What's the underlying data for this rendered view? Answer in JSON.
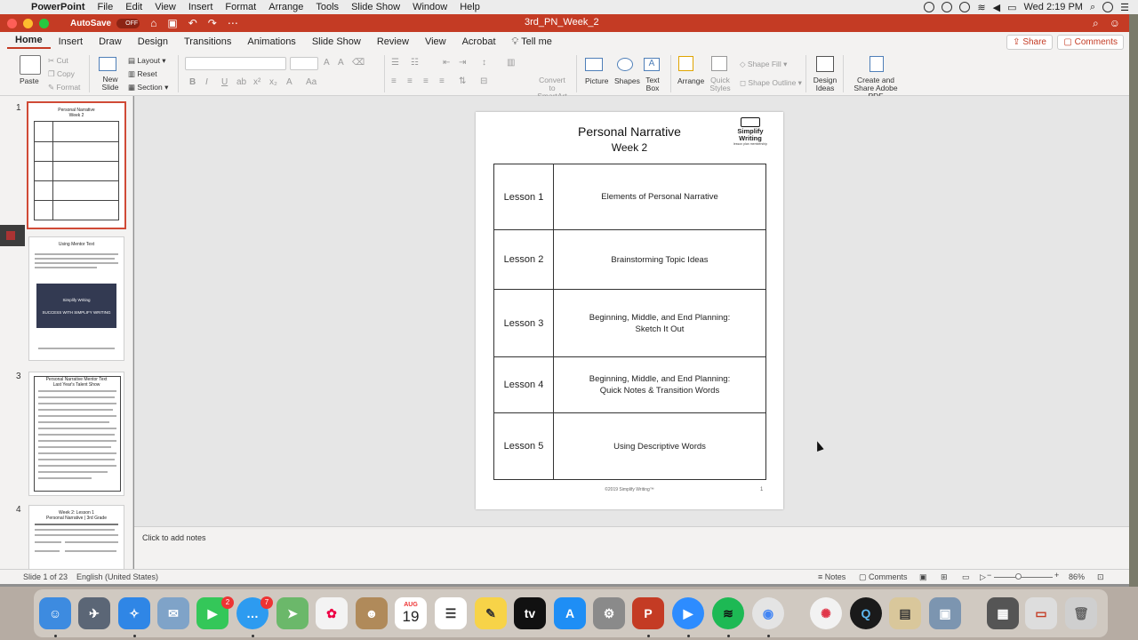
{
  "menubar": {
    "app_name": "PowerPoint",
    "items": [
      "File",
      "Edit",
      "View",
      "Insert",
      "Format",
      "Arrange",
      "Tools",
      "Slide Show",
      "Window",
      "Help"
    ],
    "clock": "Wed 2:19 PM"
  },
  "titlebar": {
    "autosave_label": "AutoSave",
    "autosave_state": "OFF",
    "document_title": "3rd_PN_Week_2"
  },
  "ribbon_tabs": [
    "Home",
    "Insert",
    "Draw",
    "Design",
    "Transitions",
    "Animations",
    "Slide Show",
    "Review",
    "View",
    "Acrobat"
  ],
  "tell_me": "Tell me",
  "share_label": "Share",
  "comments_label": "Comments",
  "ribbon": {
    "paste": "Paste",
    "cut": "Cut",
    "copy": "Copy",
    "format": "Format",
    "new_slide": "New Slide",
    "layout": "Layout",
    "reset": "Reset",
    "section": "Section",
    "convert_smartart": "Convert to SmartArt",
    "picture": "Picture",
    "shapes": "Shapes",
    "text_box": "Text Box",
    "arrange": "Arrange",
    "quick_styles": "Quick Styles",
    "shape_fill": "Shape Fill",
    "shape_outline": "Shape Outline",
    "design_ideas": "Design Ideas",
    "create_share_pdf": "Create and Share Adobe PDF"
  },
  "thumbnails": {
    "numbers": [
      "1",
      "2",
      "3",
      "4"
    ],
    "slide1_title": "Personal Narrative",
    "slide1_sub": "Week 2",
    "slide2_title": "Using Mentor Text",
    "slide2_banner1": "Simplify Writing",
    "slide2_banner2": "SUCCESS WITH SIMPLIFY WRITING",
    "slide3_title": "Personal Narrative Mentor Text",
    "slide3_sub": "Last Year's Talent Show",
    "slide4_title": "Week 2: Lesson 1",
    "slide4_sub": "Personal Narrative | 3rd Grade"
  },
  "slide": {
    "title": "Personal Narrative",
    "subtitle": "Week 2",
    "logo_text": "Simplify Writing",
    "logo_tagline": "lesson plan membership",
    "lessons": [
      {
        "label": "Lesson 1",
        "line1": "Elements of Personal Narrative",
        "line2": ""
      },
      {
        "label": "Lesson 2",
        "line1": "Brainstorming Topic Ideas",
        "line2": ""
      },
      {
        "label": "Lesson 3",
        "line1": "Beginning, Middle, and End Planning:",
        "line2": "Sketch It Out"
      },
      {
        "label": "Lesson 4",
        "line1": "Beginning, Middle, and End Planning:",
        "line2": "Quick Notes & Transition Words"
      },
      {
        "label": "Lesson 5",
        "line1": "Using Descriptive Words",
        "line2": ""
      }
    ],
    "footer": "©2019 Simplify Writing™",
    "page_number": "1"
  },
  "notes_placeholder": "Click to add notes",
  "status": {
    "slide_info": "Slide 1 of 23",
    "language": "English (United States)",
    "notes": "Notes",
    "comments": "Comments",
    "zoom": "86%"
  },
  "dock": {
    "facetime_badge": "2",
    "messages_badge": "7",
    "calendar_month": "AUG",
    "calendar_day": "19"
  }
}
